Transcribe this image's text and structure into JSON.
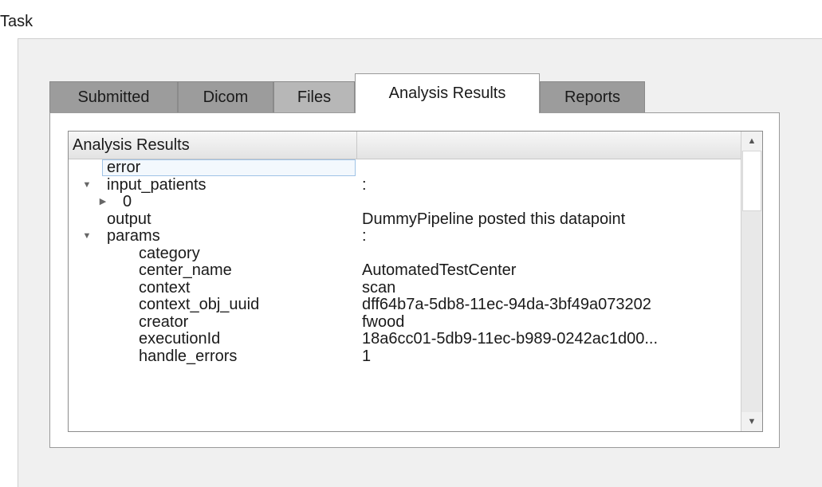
{
  "panel": {
    "title": "Task"
  },
  "tabs": [
    {
      "label": "Submitted",
      "active": false
    },
    {
      "label": "Dicom",
      "active": false
    },
    {
      "label": "Files",
      "active": false
    },
    {
      "label": "Analysis Results",
      "active": true
    },
    {
      "label": "Reports",
      "active": false
    }
  ],
  "tree": {
    "column_header": "Analysis Results",
    "column_header_2": "",
    "rows": [
      {
        "key": "error",
        "value": "",
        "depth": 0,
        "expander": "none",
        "selected": true
      },
      {
        "key": "input_patients",
        "value": ":",
        "depth": 0,
        "expander": "expanded"
      },
      {
        "key": "0",
        "value": "",
        "depth": 1,
        "expander": "collapsed"
      },
      {
        "key": "output",
        "value": "DummyPipeline posted this datapoint",
        "depth": 0,
        "expander": "none"
      },
      {
        "key": "params",
        "value": ":",
        "depth": 0,
        "expander": "expanded"
      },
      {
        "key": "category",
        "value": "",
        "depth": 1,
        "expander": "none"
      },
      {
        "key": "center_name",
        "value": "AutomatedTestCenter",
        "depth": 1,
        "expander": "none"
      },
      {
        "key": "context",
        "value": "scan",
        "depth": 1,
        "expander": "none"
      },
      {
        "key": "context_obj_uuid",
        "value": "dff64b7a-5db8-11ec-94da-3bf49a073202",
        "depth": 1,
        "expander": "none"
      },
      {
        "key": "creator",
        "value": "fwood",
        "depth": 1,
        "expander": "none"
      },
      {
        "key": "executionId",
        "value": "18a6cc01-5db9-11ec-b989-0242ac1d00...",
        "depth": 1,
        "expander": "none"
      },
      {
        "key": "handle_errors",
        "value": "1",
        "depth": 1,
        "expander": "none"
      }
    ]
  },
  "icons": {
    "expanded": "triangle-down-icon",
    "collapsed": "triangle-right-icon",
    "scroll_up": "scroll-up-arrow-icon",
    "scroll_down": "scroll-down-arrow-icon"
  }
}
